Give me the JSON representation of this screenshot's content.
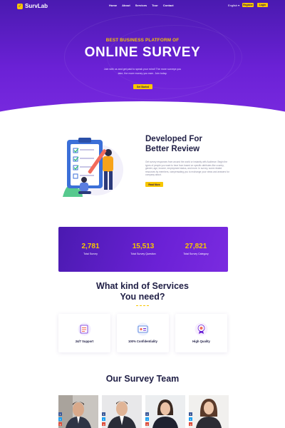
{
  "nav": {
    "logo": "SurvLab",
    "menu": [
      "Home",
      "About",
      "Services",
      "Tour",
      "Contact"
    ],
    "language": "English",
    "register": "Register",
    "login": "Login"
  },
  "hero": {
    "subtitle": "BEST BUSINESS PLATFORM OF",
    "title": "ONLINE SURVEY",
    "description": "Join with us and get paid to speak your mind! The more surveys you take, the more money you earn. Join today.",
    "cta": "Get Started"
  },
  "about": {
    "title_line1": "Developed For",
    "title_line2": "Better Review",
    "description": "Get survey responses from around the world or instantly with Audience. Begin the types of people you want to hear from based on specific attributes like country, gender, age, income, employment status, and more. In survey, some related resources by members, compensating you to exchange your views and answers for company about.",
    "cta": "Read More"
  },
  "stats": [
    {
      "number": "2,781",
      "label": "Total Survey"
    },
    {
      "number": "15,513",
      "label": "Total Survey Question"
    },
    {
      "number": "27,821",
      "label": "Total Survey Category"
    }
  ],
  "services": {
    "title_line1": "What kind of Services",
    "title_line2": "You need?",
    "items": [
      {
        "label": "24/7 Support",
        "icon": "support-icon"
      },
      {
        "label": "100% Confidentiality",
        "icon": "confidentiality-icon"
      },
      {
        "label": "High Quality",
        "icon": "quality-icon"
      }
    ]
  },
  "team": {
    "title": "Our Survey Team"
  },
  "colors": {
    "primary": "#6b21d6",
    "accent": "#f7c600",
    "heading": "#1f1e45"
  }
}
